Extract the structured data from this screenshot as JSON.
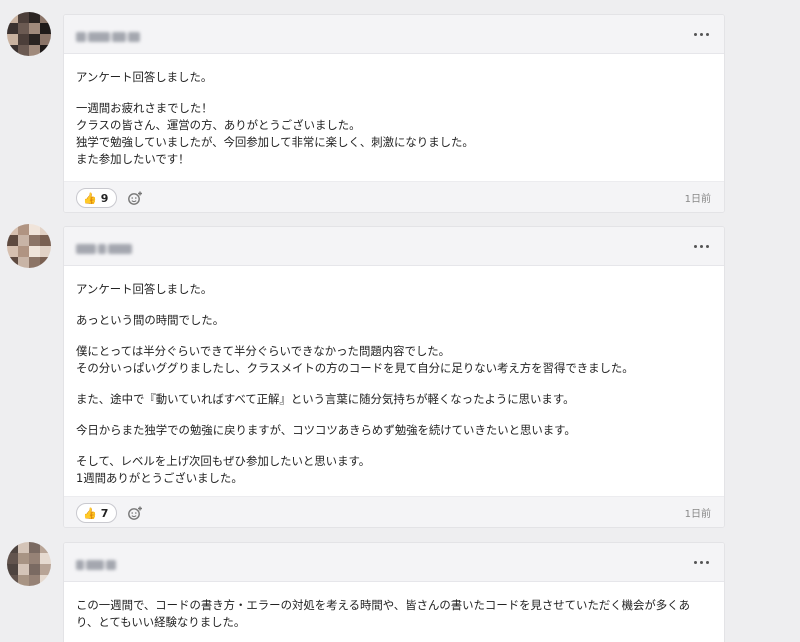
{
  "posts": [
    {
      "reactions": {
        "count": "9"
      },
      "timestamp": "1日前",
      "paragraphs": [
        "アンケート回答しました。",
        "一週間お疲れさまでした！\nクラスの皆さん、運営の方、ありがとうございました。\n独学で勉強していましたが、今回参加して非常に楽しく、刺激になりました。\nまた参加したいです！"
      ]
    },
    {
      "reactions": {
        "count": "7"
      },
      "timestamp": "1日前",
      "paragraphs": [
        "アンケート回答しました。",
        "あっという間の時間でした。",
        "僕にとっては半分ぐらいできて半分ぐらいできなかった問題内容でした。\nその分いっぱいググりましたし、クラスメイトの方のコードを見て自分に足りない考え方を習得できました。",
        "また、途中で『動いていればすべて正解』という言葉に随分気持ちが軽くなったように思います。",
        "今日からまた独学での勉強に戻りますが、コツコツあきらめず勉強を続けていきたいと思います。",
        "そして、レベルを上げ次回もぜひ参加したいと思います。\n1週間ありがとうございました。"
      ]
    },
    {
      "paragraphs": [
        "この一週間で、コードの書き方・エラーの対処を考える時間や、皆さんの書いたコードを見させていただく機会が多くあり、とてもいい経験なりました。"
      ]
    }
  ],
  "icons": {
    "reaction": "thumbs-up-icon",
    "add_reaction": "add-reaction-icon",
    "menu": "more-horizontal-icon",
    "avatar": "pixelated-avatar"
  },
  "colors": {
    "page_bg": "#eeeef0",
    "card_bg": "#ffffff",
    "header_bg": "#f4f4f6",
    "text": "#222222",
    "muted": "#888888"
  }
}
